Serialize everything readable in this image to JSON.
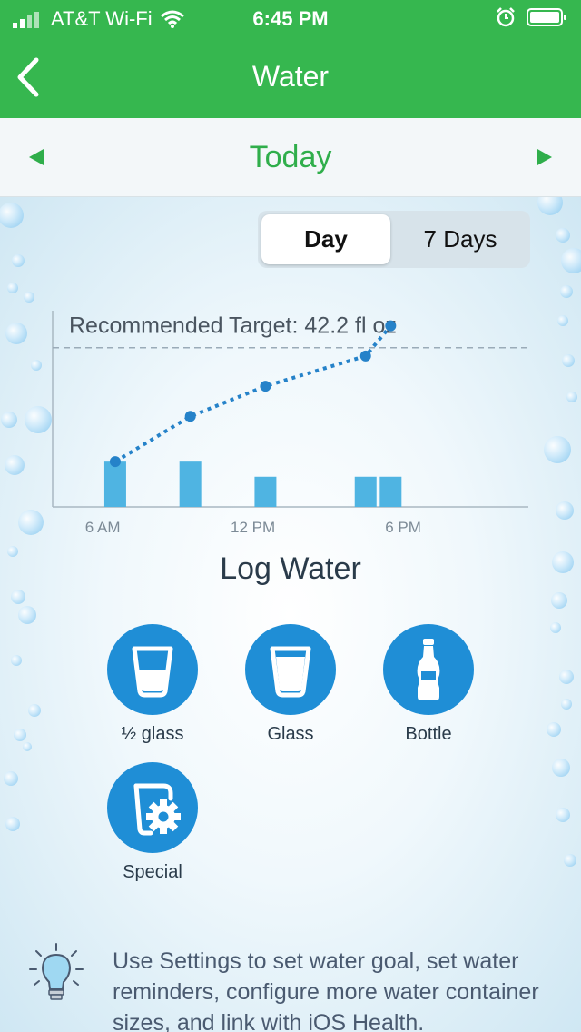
{
  "status_bar": {
    "carrier": "AT&T Wi-Fi",
    "time": "6:45 PM"
  },
  "nav": {
    "title": "Water"
  },
  "date_nav": {
    "label": "Today"
  },
  "segment": {
    "day_label": "Day",
    "week_label": "7 Days",
    "selected": "Day"
  },
  "colors": {
    "header_green": "#36b74f",
    "today_green": "#2fae4b",
    "accent_blue": "#1f8ed6",
    "bar_blue": "#4fb4e2",
    "line_blue": "#2582c9"
  },
  "chart_data": {
    "type": "bar",
    "target_label": "Recommended Target: 42.2 fl oz",
    "target_value": 42.2,
    "x_tick_labels": [
      "6 AM",
      "12 PM",
      "6 PM"
    ],
    "x_ticks": [
      6,
      12,
      18
    ],
    "xlim": [
      4,
      23
    ],
    "ylim": [
      0,
      52
    ],
    "bars": [
      {
        "x": 6.5,
        "value": 12
      },
      {
        "x": 9.5,
        "value": 12
      },
      {
        "x": 12.5,
        "value": 8
      },
      {
        "x": 16.5,
        "value": 8
      },
      {
        "x": 17.5,
        "value": 8
      }
    ],
    "cumulative_line": [
      {
        "x": 6.5,
        "value": 12
      },
      {
        "x": 9.5,
        "value": 24
      },
      {
        "x": 12.5,
        "value": 32
      },
      {
        "x": 16.5,
        "value": 40
      },
      {
        "x": 17.5,
        "value": 48
      }
    ]
  },
  "log": {
    "title": "Log Water",
    "buttons": [
      {
        "label": "½ glass",
        "icon": "half-glass-icon"
      },
      {
        "label": "Glass",
        "icon": "glass-icon"
      },
      {
        "label": "Bottle",
        "icon": "bottle-icon"
      },
      {
        "label": "Special",
        "icon": "special-settings-icon"
      }
    ]
  },
  "tip": {
    "icon": "lightbulb-icon",
    "text": "Use Settings to set water goal, set water reminders, configure more water container sizes, and link with iOS Health."
  }
}
